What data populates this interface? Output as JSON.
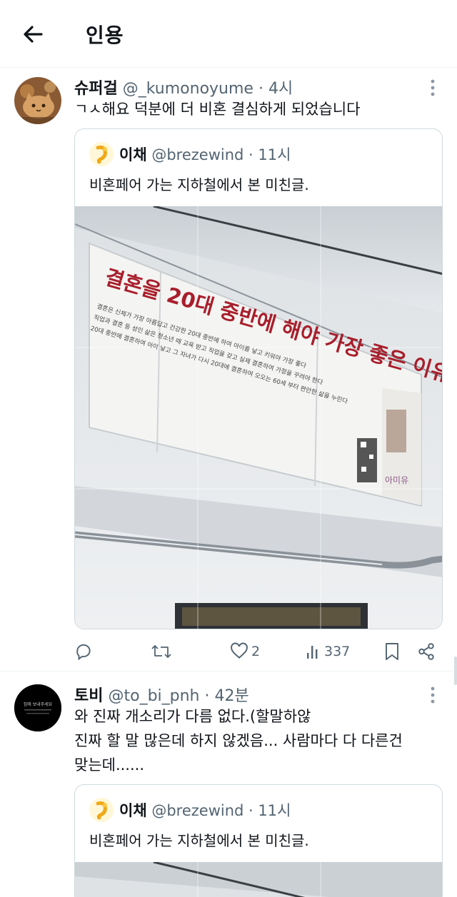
{
  "header": {
    "title": "인용"
  },
  "tweets": [
    {
      "name": "슈퍼걸",
      "handle": "@_kumonoyume",
      "time": "· 4시",
      "text": "ㄱㅅ해요 덕분에 더 비혼 결심하게 되었습니다",
      "quote": {
        "name": "이채",
        "handle": "@brezewind",
        "time": "· 11시",
        "text": "비혼페어 가는 지하철에서 본 미친글.",
        "image": {
          "ad_headline": "결혼을 20대 중반에 해야 가장 좋은 이유",
          "ad_lines": [
            "결혼은 신체가 가장 아름답고 건강한 20대 중반에 하여 아이를 낳고 키워야 가장 좋다",
            "직업과 결혼 등 성인 삶은 청소년 때 교육 받고 직업을 갖고 실제 결혼하여 가정을 꾸려야 한다",
            "20대 중반에 결혼하여 아이 낳고 그 자녀가 다시 20대에 결혼하여 오오는 60세 부터 편안한 삶을 누린다"
          ],
          "ad_brand": "아미유"
        }
      },
      "actions": {
        "likes": "2",
        "views": "337"
      }
    },
    {
      "name": "토비",
      "handle": "@to_bi_pnh",
      "time": "· 42분",
      "text_lines": [
        "와 진짜 개소리가 다름 없다.(할말하않",
        "진짜 할 말 많은데 하지 않겠음... 사람마다 다 다른건",
        "맞는데......"
      ],
      "avatar_text": "집에 보내주세요",
      "quote": {
        "name": "이채",
        "handle": "@brezewind",
        "time": "· 11시",
        "text": "비혼페어 가는 지하철에서 본 미친글."
      }
    }
  ],
  "colors": {
    "text": "#0f1419",
    "secondary": "#536471",
    "border": "#cfd9de",
    "ad_red": "#a81e2b"
  }
}
